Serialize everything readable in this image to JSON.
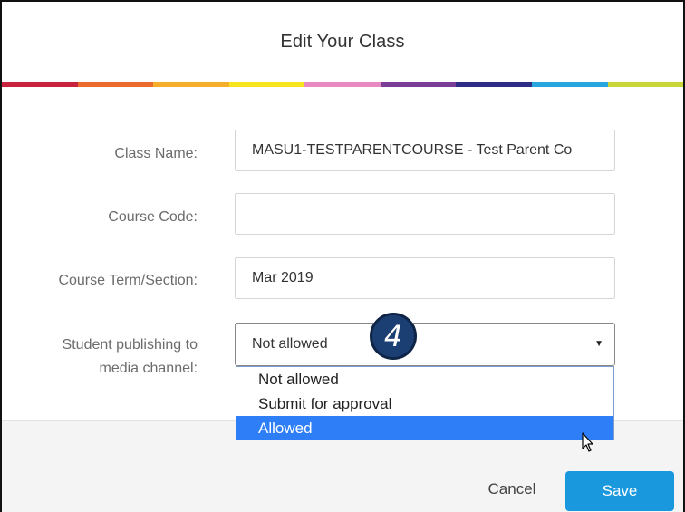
{
  "dialog": {
    "title": "Edit Your Class"
  },
  "rainbow_colors": [
    "#c8223f",
    "#ea6b2d",
    "#f6ae2b",
    "#f7e41f",
    "#e889c1",
    "#7a3e96",
    "#2d2d86",
    "#27a6df",
    "#c9d637"
  ],
  "form": {
    "class_name": {
      "label": "Class Name:",
      "value": "MASU1-TESTPARENTCOURSE - Test Parent Co"
    },
    "course_code": {
      "label": "Course Code:",
      "value": ""
    },
    "course_term": {
      "label": "Course Term/Section:",
      "value": "Mar 2019"
    },
    "student_publishing": {
      "label_line1": "Student publishing to",
      "label_line2": "media channel:",
      "selected": "Not allowed",
      "options": [
        "Not allowed",
        "Submit for approval",
        "Allowed"
      ],
      "highlighted_index": 2
    }
  },
  "badge": {
    "number": "4"
  },
  "footer": {
    "cancel_label": "Cancel",
    "save_label": "Save"
  },
  "colors": {
    "save_button": "#1a98de",
    "dropdown_highlight": "#2d7ef7",
    "badge": "#1c3f73"
  }
}
